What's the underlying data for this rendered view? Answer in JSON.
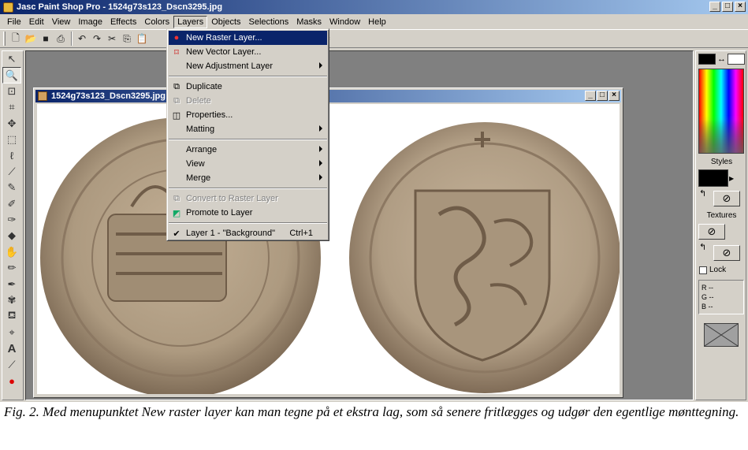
{
  "window": {
    "title": "Jasc Paint Shop Pro - 1524g73s123_Dscn3295.jpg",
    "min_label": "_",
    "max_label": "□",
    "close_label": "×"
  },
  "menubar": [
    "File",
    "Edit",
    "View",
    "Image",
    "Effects",
    "Colors",
    "Layers",
    "Objects",
    "Selections",
    "Masks",
    "Window",
    "Help"
  ],
  "document": {
    "title": "1524g73s123_Dscn3295.jpg"
  },
  "layers_menu": {
    "items": [
      {
        "label": "New Raster Layer...",
        "icon": "raster-layer-icon",
        "highlighted": true,
        "submenu": false
      },
      {
        "label": "New Vector Layer...",
        "icon": "vector-layer-icon",
        "submenu": false
      },
      {
        "label": "New Adjustment Layer",
        "submenu": true
      },
      {
        "label": "Duplicate",
        "icon": "duplicate-icon",
        "submenu": false
      },
      {
        "label": "Delete",
        "icon": "delete-icon",
        "disabled": true,
        "submenu": false
      },
      {
        "label": "Properties...",
        "icon": "properties-icon",
        "submenu": false
      },
      {
        "label": "Matting",
        "submenu": true
      },
      {
        "label": "Arrange",
        "submenu": true
      },
      {
        "label": "View",
        "submenu": true
      },
      {
        "label": "Merge",
        "submenu": true
      },
      {
        "label": "Convert to Raster Layer",
        "icon": "convert-icon",
        "disabled": true,
        "submenu": false
      },
      {
        "label": "Promote to Layer",
        "icon": "promote-icon",
        "submenu": false
      },
      {
        "label": "Layer 1 - \"Background\"",
        "icon": "check-icon",
        "shortcut": "Ctrl+1",
        "submenu": false
      }
    ]
  },
  "right_palette": {
    "styles_label": "Styles",
    "textures_label": "Textures",
    "lock_label": "Lock",
    "rgb": {
      "r": "R   --",
      "g": "G   --",
      "b": "B   --"
    }
  },
  "caption": "Fig. 2. Med menupunktet New raster layer kan man tegne på et ekstra lag, som så senere fritlægges og udgør den egentlige mønttegning.",
  "colors": {
    "titlebar_start": "#0a246a",
    "titlebar_end": "#a6caf0",
    "chrome": "#d4d0c8",
    "workspace": "#808080",
    "coin": "#b39f86"
  }
}
